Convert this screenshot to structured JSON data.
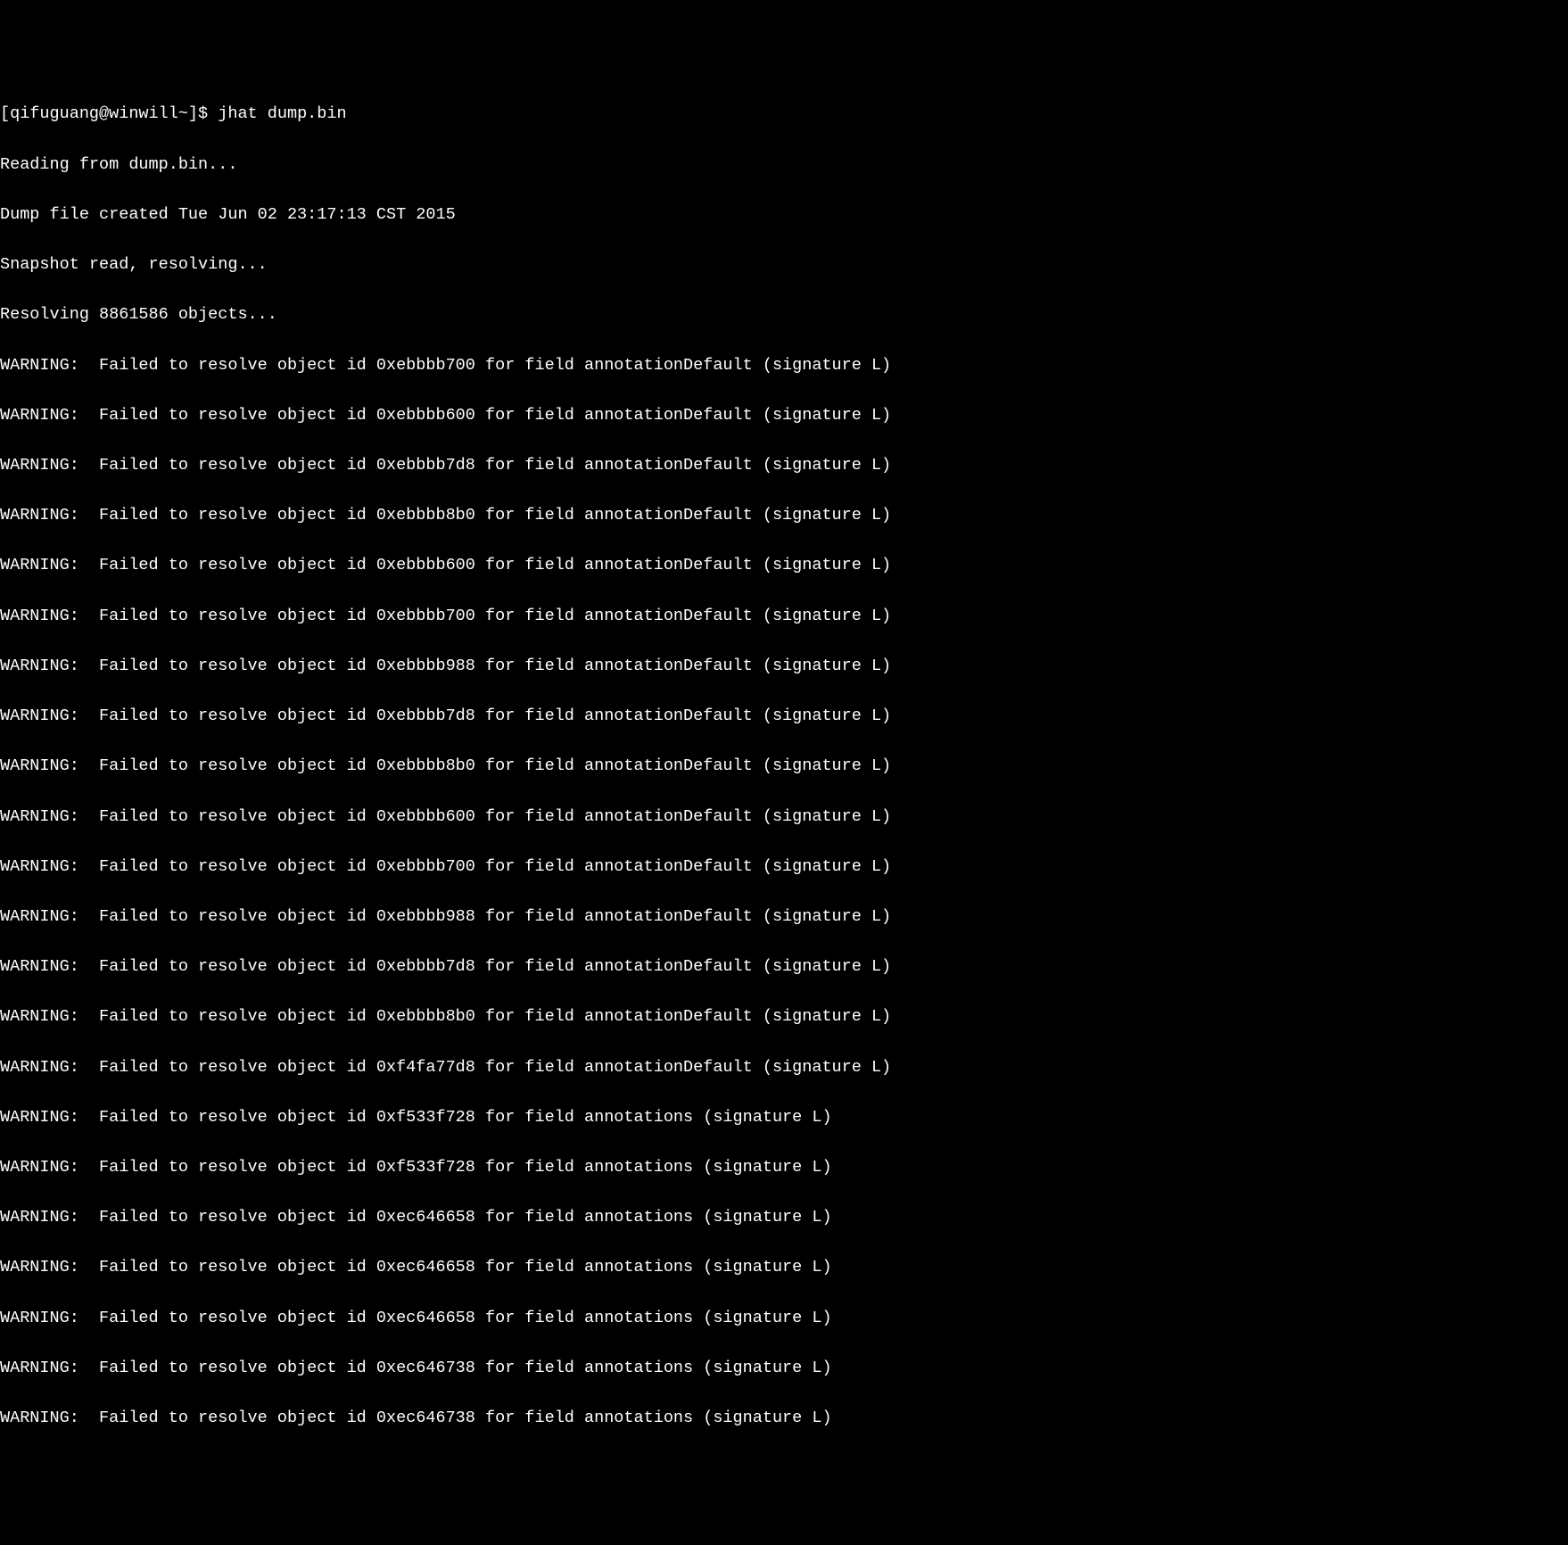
{
  "prompt": {
    "user_host": "[qifuguang@winwill~]$ ",
    "command": "jhat dump.bin"
  },
  "status_lines": [
    "Reading from dump.bin...",
    "Dump file created Tue Jun 02 23:17:13 CST 2015",
    "Snapshot read, resolving...",
    "Resolving 8861586 objects..."
  ],
  "warnings": [
    "WARNING:  Failed to resolve object id 0xebbbb700 for field annotationDefault (signature L)",
    "WARNING:  Failed to resolve object id 0xebbbb600 for field annotationDefault (signature L)",
    "WARNING:  Failed to resolve object id 0xebbbb7d8 for field annotationDefault (signature L)",
    "WARNING:  Failed to resolve object id 0xebbbb8b0 for field annotationDefault (signature L)",
    "WARNING:  Failed to resolve object id 0xebbbb600 for field annotationDefault (signature L)",
    "WARNING:  Failed to resolve object id 0xebbbb700 for field annotationDefault (signature L)",
    "WARNING:  Failed to resolve object id 0xebbbb988 for field annotationDefault (signature L)",
    "WARNING:  Failed to resolve object id 0xebbbb7d8 for field annotationDefault (signature L)",
    "WARNING:  Failed to resolve object id 0xebbbb8b0 for field annotationDefault (signature L)",
    "WARNING:  Failed to resolve object id 0xebbbb600 for field annotationDefault (signature L)",
    "WARNING:  Failed to resolve object id 0xebbbb700 for field annotationDefault (signature L)",
    "WARNING:  Failed to resolve object id 0xebbbb988 for field annotationDefault (signature L)",
    "WARNING:  Failed to resolve object id 0xebbbb7d8 for field annotationDefault (signature L)",
    "WARNING:  Failed to resolve object id 0xebbbb8b0 for field annotationDefault (signature L)",
    "WARNING:  Failed to resolve object id 0xf4fa77d8 for field annotationDefault (signature L)",
    "WARNING:  Failed to resolve object id 0xf533f728 for field annotations (signature L)",
    "WARNING:  Failed to resolve object id 0xf533f728 for field annotations (signature L)",
    "WARNING:  Failed to resolve object id 0xec646658 for field annotations (signature L)",
    "WARNING:  Failed to resolve object id 0xec646658 for field annotations (signature L)",
    "WARNING:  Failed to resolve object id 0xec646658 for field annotations (signature L)",
    "WARNING:  Failed to resolve object id 0xec646738 for field annotations (signature L)",
    "WARNING:  Failed to resolve object id 0xec646738 for field annotations (signature L)"
  ]
}
